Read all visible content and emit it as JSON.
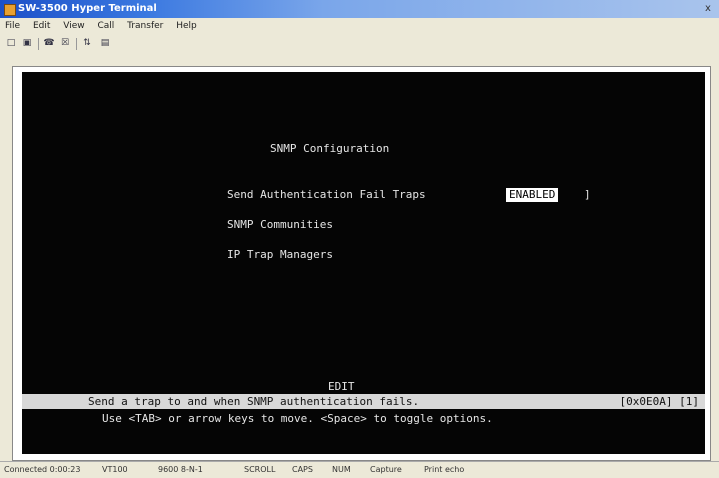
{
  "window": {
    "title": "SW-3500 Hyper Terminal",
    "close_glyph": "x"
  },
  "menu": [
    "File",
    "Edit",
    "View",
    "Call",
    "Transfer",
    "Help"
  ],
  "toolbar": {
    "icons": [
      "new-icon",
      "open-icon",
      "connect-icon",
      "disconnect-icon",
      "send-icon",
      "properties-icon"
    ]
  },
  "terminal": {
    "title": "SNMP Configuration",
    "items": [
      {
        "label": "Send Authentication Fail Traps",
        "value": "ENABLED",
        "bracket": "]"
      },
      {
        "label": "SNMP Communities"
      },
      {
        "label": "IP Trap Managers"
      }
    ],
    "mode": "EDIT",
    "status_message": "Send a trap to and when SNMP authentication fails.",
    "status_position": "[0x0E0A] [1]",
    "help_line": "Use <TAB> or arrow keys to move. <Space> to toggle options."
  },
  "statusbar": {
    "items": [
      "Connected 0:00:23",
      "VT100",
      "9600 8-N-1",
      "SCROLL",
      "CAPS",
      "NUM",
      "Capture",
      "Print echo"
    ]
  }
}
